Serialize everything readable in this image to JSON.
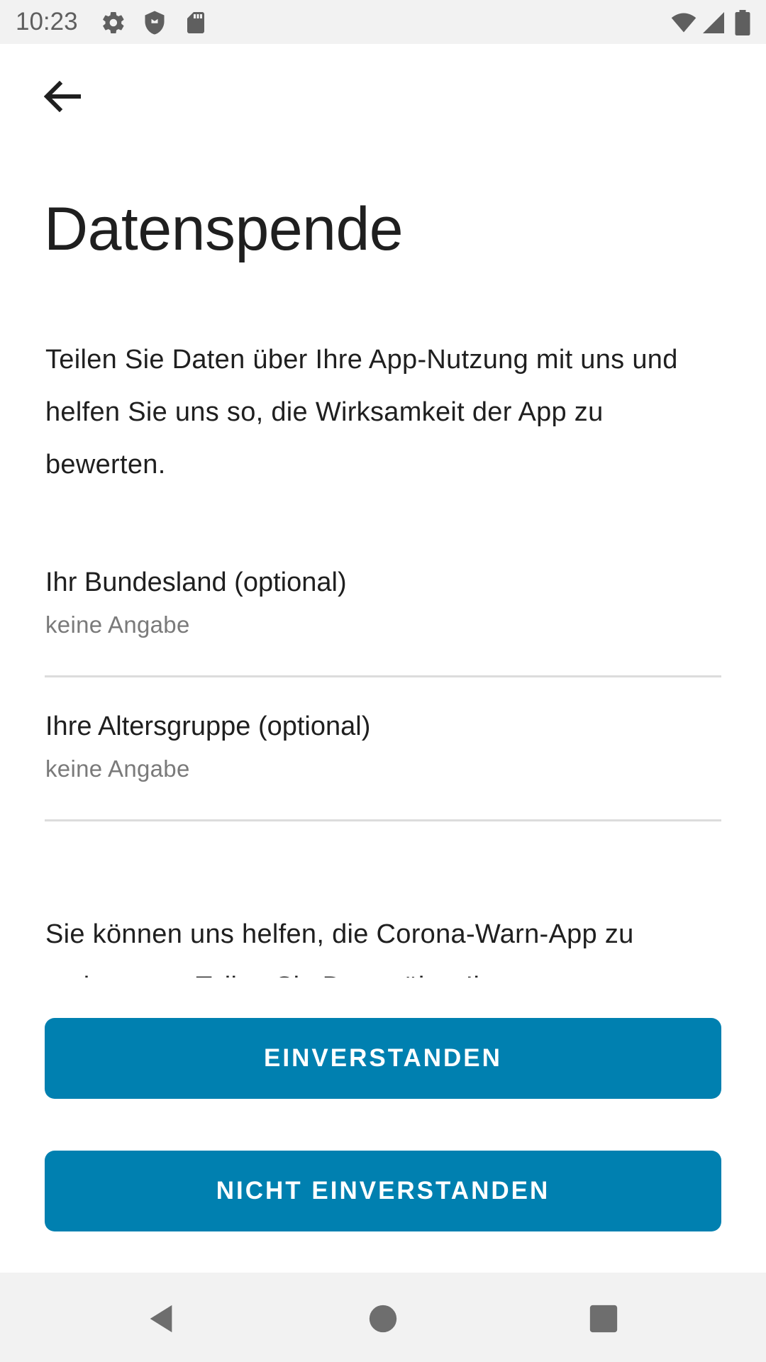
{
  "status_bar": {
    "time": "10:23",
    "icons_left": [
      "gear-icon",
      "shield-icon",
      "sd-card-icon"
    ],
    "icons_right": [
      "wifi-icon",
      "signal-icon",
      "battery-icon"
    ]
  },
  "header": {
    "back_icon": "arrow-back-icon",
    "title": "Datenspende"
  },
  "intro": {
    "text": "Teilen Sie Daten über Ihre App-Nutzung mit uns und helfen Sie uns so, die Wirksamkeit der App zu bewerten."
  },
  "selectors": [
    {
      "label": "Ihr Bundesland (optional)",
      "value": "keine Angabe"
    },
    {
      "label": "Ihre Altersgruppe (optional)",
      "value": "keine Angabe"
    }
  ],
  "help": {
    "text": "Sie können uns helfen, die Corona-Warn-App zu verbessern. Teilen Sie Daten über Ihre"
  },
  "buttons": {
    "accept_label": "EINVERSTANDEN",
    "decline_label": "NICHT EINVERSTANDEN"
  },
  "navigation": {
    "back": "nav-back-icon",
    "home": "nav-home-icon",
    "recents": "nav-recents-icon"
  },
  "colors": {
    "accent": "#0080b0",
    "bar_background": "#f2f2f2",
    "text": "#1f1f1f",
    "secondary_text": "#7a7a7a"
  }
}
